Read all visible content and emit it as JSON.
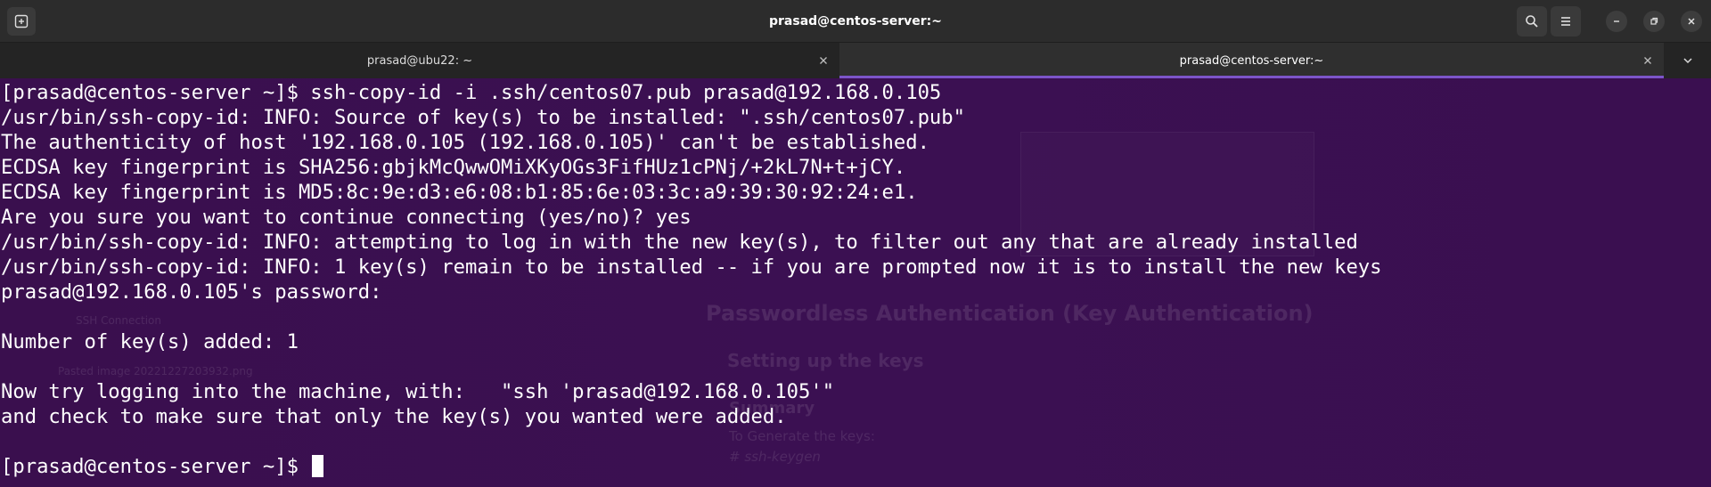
{
  "window": {
    "title": "prasad@centos-server:~"
  },
  "tabs": [
    {
      "label": "prasad@ubu22: ~",
      "active": false
    },
    {
      "label": "prasad@centos-server:~",
      "active": true
    }
  ],
  "terminal": {
    "lines": [
      "[prasad@centos-server ~]$ ssh-copy-id -i .ssh/centos07.pub prasad@192.168.0.105",
      "/usr/bin/ssh-copy-id: INFO: Source of key(s) to be installed: \".ssh/centos07.pub\"",
      "The authenticity of host '192.168.0.105 (192.168.0.105)' can't be established.",
      "ECDSA key fingerprint is SHA256:gbjkMcQwwOMiXKyOGs3FifHUz1cPNj/+2kL7N+t+jCY.",
      "ECDSA key fingerprint is MD5:8c:9e:d3:e6:08:b1:85:6e:03:3c:a9:39:30:92:24:e1.",
      "Are you sure you want to continue connecting (yes/no)? yes",
      "/usr/bin/ssh-copy-id: INFO: attempting to log in with the new key(s), to filter out any that are already installed",
      "/usr/bin/ssh-copy-id: INFO: 1 key(s) remain to be installed -- if you are prompted now it is to install the new keys",
      "prasad@192.168.0.105's password:",
      "",
      "Number of key(s) added: 1",
      "",
      "Now try logging into the machine, with:   \"ssh 'prasad@192.168.0.105'\"",
      "and check to make sure that only the key(s) you wanted were added.",
      ""
    ],
    "prompt": "[prasad@centos-server ~]$ "
  },
  "background_ghost": {
    "heading": "Passwordless Authentication (Key Authentication)",
    "subheading": "Setting up the keys",
    "section": "Summary",
    "text": "To Generate the keys:",
    "command": "# ssh-keygen",
    "side1": "SSH Connection",
    "side2": "Pasted image 20221227203932.png"
  },
  "colors": {
    "terminal_bg": "#3b1052",
    "titlebar_bg": "#2c2c2c",
    "tab_active_indicator": "#7c55c9",
    "text": "#ffffff"
  }
}
